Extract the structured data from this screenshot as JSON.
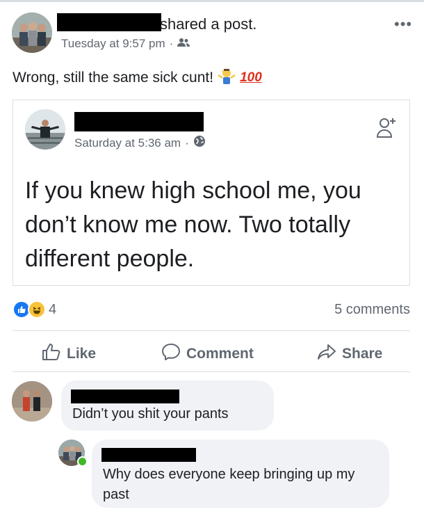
{
  "post": {
    "action_text": "shared a post.",
    "time": "Tuesday at 9:57 pm",
    "separator": "·",
    "more": "•••",
    "caption": "Wrong, still the same sick cunt!",
    "caption_badge": "100",
    "privacy_icon": "friends-icon"
  },
  "shared_post": {
    "time": "Saturday at 5:36 am",
    "separator": "·",
    "privacy_icon": "globe-icon",
    "text": "If you knew high school me, you don’t know me now. Two totally different people."
  },
  "reactions": {
    "count": "4",
    "comments": "5 comments",
    "colors": {
      "like": "#1877f2",
      "haha": "#f7c33a"
    }
  },
  "actions": {
    "like": "Like",
    "comment": "Comment",
    "share": "Share"
  },
  "comments": [
    {
      "text": "Didn’t you shit your pants"
    },
    {
      "text": "Why does everyone keep bringing up my past"
    }
  ]
}
